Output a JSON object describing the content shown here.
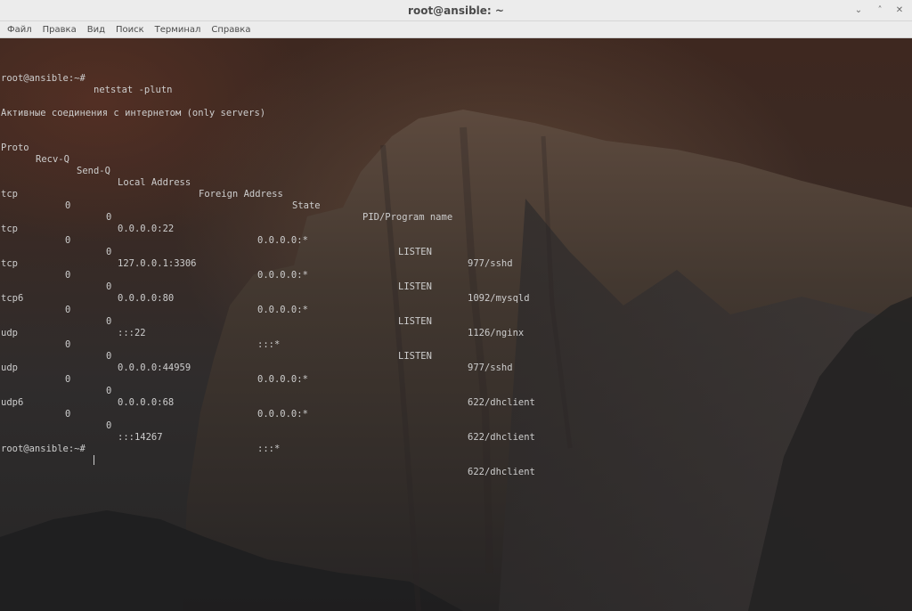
{
  "window": {
    "title": "root@ansible: ~",
    "controls": {
      "minimize_icon": "minimize-icon",
      "maximize_icon": "maximize-icon",
      "close_icon": "close-icon",
      "minimize_glyph": "⌄",
      "maximize_glyph": "˄",
      "close_glyph": "✕"
    }
  },
  "menu": {
    "items": [
      "Файл",
      "Правка",
      "Вид",
      "Поиск",
      "Терминал",
      "Справка"
    ]
  },
  "terminal": {
    "prompt": "root@ansible:~#",
    "command": "netstat -plutn",
    "info_line": "Активные соединения с интернетом (only servers)",
    "headers": {
      "proto": "Proto",
      "recvq": "Recv-Q",
      "sendq": "Send-Q",
      "local": "Local Address",
      "foreign": "Foreign Address",
      "state": "State",
      "pid": "PID/Program name"
    },
    "rows": [
      {
        "proto": "tcp",
        "recvq": "0",
        "sendq": "0",
        "local": "0.0.0.0:22",
        "foreign": "0.0.0.0:*",
        "state": "LISTEN",
        "pid": "977/sshd"
      },
      {
        "proto": "tcp",
        "recvq": "0",
        "sendq": "0",
        "local": "127.0.0.1:3306",
        "foreign": "0.0.0.0:*",
        "state": "LISTEN",
        "pid": "1092/mysqld"
      },
      {
        "proto": "tcp",
        "recvq": "0",
        "sendq": "0",
        "local": "0.0.0.0:80",
        "foreign": "0.0.0.0:*",
        "state": "LISTEN",
        "pid": "1126/nginx"
      },
      {
        "proto": "tcp6",
        "recvq": "0",
        "sendq": "0",
        "local": ":::22",
        "foreign": ":::*",
        "state": "LISTEN",
        "pid": "977/sshd"
      },
      {
        "proto": "udp",
        "recvq": "0",
        "sendq": "0",
        "local": "0.0.0.0:44959",
        "foreign": "0.0.0.0:*",
        "state": "",
        "pid": "622/dhclient"
      },
      {
        "proto": "udp",
        "recvq": "0",
        "sendq": "0",
        "local": "0.0.0.0:68",
        "foreign": "0.0.0.0:*",
        "state": "",
        "pid": "622/dhclient"
      },
      {
        "proto": "udp6",
        "recvq": "0",
        "sendq": "0",
        "local": ":::14267",
        "foreign": ":::*",
        "state": "",
        "pid": "622/dhclient"
      }
    ],
    "final_prompt": "root@ansible:~#",
    "text_color": "#cdcdcd"
  }
}
